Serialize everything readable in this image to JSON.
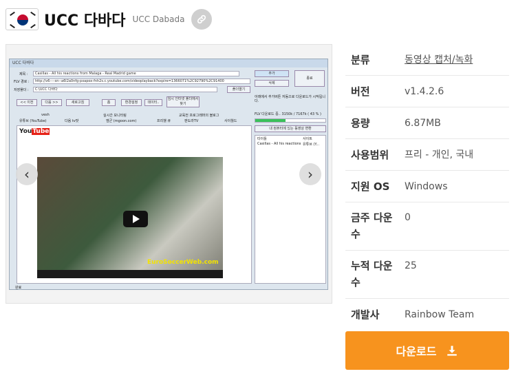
{
  "header": {
    "title": "UCC 다바다",
    "subtitle": "UCC Dabada"
  },
  "gallery": {
    "window": {
      "title": "UCC 다바다",
      "url_label": "제목 :",
      "url_value": "Casillas - All his reactions from Malaga - Real Madrid game",
      "flv_label": "FLV 경로 :",
      "flv_value": "http://v6----sn--a6l2a0nfg-pxapox-fnh2s.c.youtube.com/videoplayback?expire=1366071%2C92790%2C91400",
      "save_label": "저장폴더 :",
      "save_value": "C:\\UCC 다바다",
      "add_button": "추가",
      "delete_button": "삭제",
      "close_button": "종료",
      "folder_button": "폴더열기",
      "nav_buttons": [
        "<< 이전",
        "다음 >>",
        "새로고침",
        "홈",
        "환경설정",
        "데이터..",
        "임시 인터넷 폴더에서 찾기"
      ],
      "tabs_top": [
        "vesh",
        "실시간 모니터링",
        "교육전 프로그래머의 블로그"
      ],
      "tabs_bottom": [
        "유튜브 (YouTube)",
        "다음 tv팟",
        "엠군 (mgoon.com)",
        "프리챌 큐",
        "판도라TV",
        "사이월드"
      ],
      "video_title": "Casillas - All his reactions from Malaga - Real Madrid game",
      "watermark": "EuroSoccerWeb.com",
      "status_text": "FLV 다운로드 중.. 3150k / 7167k ( 43 % )",
      "convert_button": "내 컴퓨터에 있는 동영상 변환",
      "right_col_title": "타이틀",
      "right_col_site": "사이트",
      "right_row_title": "Casillas - All his reactions...",
      "right_row_site": "유튜브 (Y...",
      "hint_text": "아래에서 추가버튼 자동으로 다운로드가 시작됩니다.",
      "bottom_status": "완료",
      "progress": 0.43
    }
  },
  "info": [
    {
      "label": "분류",
      "value": "동영상 캡처/녹화",
      "link": true
    },
    {
      "label": "버전",
      "value": "v1.4.2.6",
      "link": false
    },
    {
      "label": "용량",
      "value": "6.87MB",
      "link": false
    },
    {
      "label": "사용범위",
      "value": "프리 - 개인, 국내",
      "link": false
    },
    {
      "label": "지원 OS",
      "value": "Windows",
      "link": false
    },
    {
      "label": "금주 다운수",
      "value": "0",
      "link": false
    },
    {
      "label": "누적 다운수",
      "value": "25",
      "link": false
    },
    {
      "label": "개발사",
      "value": "Rainbow Team",
      "link": false
    }
  ],
  "download": {
    "label": "다운로드",
    "color": "#f7931e"
  },
  "icons": {
    "link": "link-icon",
    "download": "download-icon",
    "prev": "chevron-left-icon",
    "next": "chevron-right-icon"
  }
}
